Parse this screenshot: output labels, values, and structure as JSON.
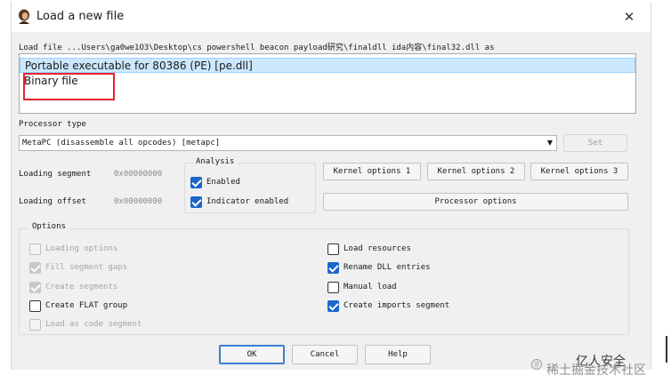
{
  "window": {
    "title": "Load a new file",
    "close_glyph": "✕"
  },
  "load_file": {
    "label": "Load file ...Users\\ga0we1O3\\Desktop\\cs powershell beacon payload研究\\finaldll ida内容\\final32.dll as",
    "options": [
      "Portable executable for 80386 (PE) [pe.dll]",
      "Binary file"
    ],
    "selected_index": 0
  },
  "processor": {
    "label": "Processor type",
    "value": "MetaPC (disassemble all opcodes) [metapc]",
    "set_label": "Set"
  },
  "loading": {
    "segment_label": "Loading segment",
    "segment_value": "0x00000000",
    "offset_label": "Loading offset",
    "offset_value": "0x00000000"
  },
  "analysis": {
    "label": "Analysis",
    "enabled_label": "Enabled",
    "enabled": true,
    "indicator_label": "Indicator enabled",
    "indicator": true
  },
  "kernel": {
    "opt1": "Kernel options 1",
    "opt2": "Kernel options 2",
    "opt3": "Kernel options 3",
    "processor_options": "Processor options"
  },
  "options": {
    "label": "Options",
    "left": [
      {
        "label": "Loading options",
        "checked": false,
        "disabled": true
      },
      {
        "label": "Fill segment gaps",
        "checked": true,
        "disabled": true
      },
      {
        "label": "Create segments",
        "checked": true,
        "disabled": true
      },
      {
        "label": "Create FLAT group",
        "checked": false,
        "disabled": false
      },
      {
        "label": "Load as code segment",
        "checked": false,
        "disabled": true
      }
    ],
    "right": [
      {
        "label": "Load resources",
        "checked": false,
        "disabled": false
      },
      {
        "label": "Rename DLL entries",
        "checked": true,
        "disabled": false
      },
      {
        "label": "Manual load",
        "checked": false,
        "disabled": false
      },
      {
        "label": "Create imports segment",
        "checked": true,
        "disabled": false
      }
    ]
  },
  "buttons": {
    "ok": "OK",
    "cancel": "Cancel",
    "help": "Help"
  },
  "watermark": {
    "line1": "亿人安全",
    "line2": "稀土掘金技术社区",
    "at": "@"
  },
  "colors": {
    "selection": "#cce8ff",
    "checkbox_accent": "#1a66c9",
    "highlight_box": "#e8212f"
  }
}
